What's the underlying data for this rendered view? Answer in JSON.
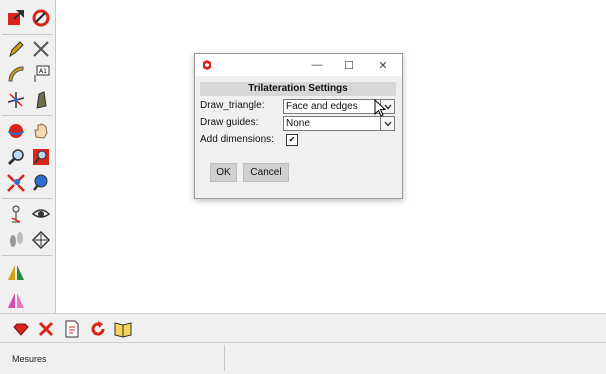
{
  "dialog": {
    "header": "Trilateration Settings",
    "window_controls": {
      "minimize": "—",
      "maximize": "☐",
      "close": "✕"
    },
    "fields": [
      {
        "label": "Draw_triangle:",
        "value": "Face and edges"
      },
      {
        "label": "Draw guides:",
        "value": "None"
      }
    ],
    "add_dimensions": {
      "label": "Add dimensions:",
      "checked": true,
      "check_glyph": "✔"
    },
    "ok_label": "OK",
    "cancel_label": "Cancel"
  },
  "status_bar": {
    "label": "Mesures"
  },
  "left_toolbar": {
    "icons": [
      "select-icon",
      "paint-icon",
      "pencil-icon",
      "arc-icon",
      "protractor-icon",
      "text-icon",
      "axes-icon",
      "section-icon",
      "orbit-icon",
      "pan-icon",
      "zoom-icon",
      "zoom-window-icon",
      "zoom-extents-icon",
      "previous-view-icon",
      "position-camera-icon",
      "look-around-icon",
      "walk-icon",
      "tape-icon",
      "mirror-icon",
      "flip-icon"
    ]
  },
  "bottom_toolbar": {
    "icons": [
      "ruby-icon",
      "delete-icon",
      "document-icon",
      "redo-icon",
      "book-icon"
    ]
  },
  "colors": {
    "accent_red": "#d9231b",
    "dialog_bg": "#f0f0f0",
    "header_bg": "#d7d7d7"
  }
}
